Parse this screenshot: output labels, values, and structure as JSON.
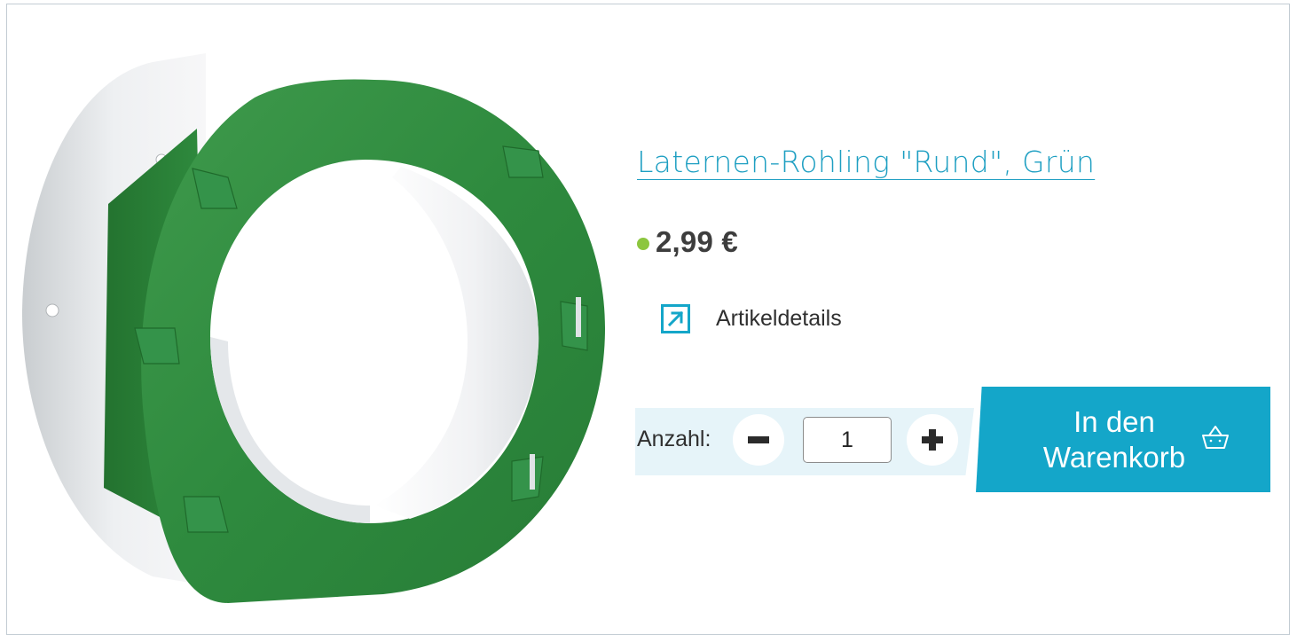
{
  "product": {
    "title": "Laternen-Rohling \"Rund\", Grün",
    "price": "2,99 €",
    "stock_indicator_color": "#8cc63f",
    "image_alt": "Laternen-Rohling Rund Grün"
  },
  "details_link": {
    "label": "Artikeldetails",
    "icon": "external-arrow-icon"
  },
  "quantity": {
    "label": "Anzahl:",
    "value": "1",
    "decrement_icon": "minus-icon",
    "increment_icon": "plus-icon"
  },
  "cart_button": {
    "label": "In den Warenkorb",
    "icon": "basket-icon"
  },
  "colors": {
    "accent": "#14a6c9",
    "title_link": "#1e9fc2",
    "lantern_green": "#2e8a3e",
    "qty_panel": "#e6f4f9"
  }
}
